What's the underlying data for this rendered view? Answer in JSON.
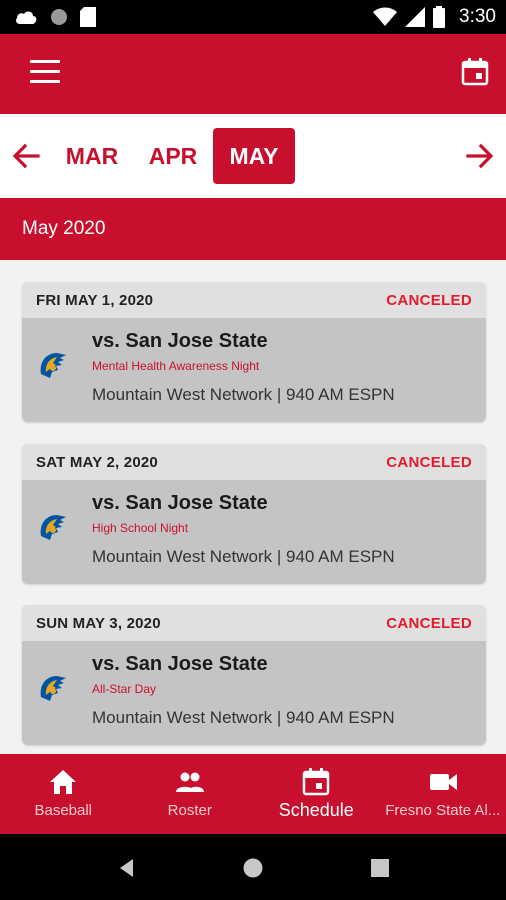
{
  "status_bar": {
    "time": "3:30",
    "icons": [
      "cloud-icon",
      "circle-icon",
      "sd-card-icon",
      "wifi-icon",
      "signal-icon",
      "battery-icon"
    ]
  },
  "app_bar": {
    "menu_icon": "hamburger-menu-icon",
    "calendar_icon": "calendar-icon"
  },
  "month_nav": {
    "prev_icon": "arrow-left-icon",
    "next_icon": "arrow-right-icon",
    "months": [
      "MAR",
      "APR",
      "MAY"
    ],
    "selected": "MAY"
  },
  "section": {
    "title": "May 2020"
  },
  "games": [
    {
      "date": "FRI MAY 1, 2020",
      "status": "CANCELED",
      "opponent": "vs. San Jose State",
      "promo": "Mental Health Awareness Night",
      "broadcast": "Mountain West Network | 940 AM ESPN"
    },
    {
      "date": "SAT MAY 2, 2020",
      "status": "CANCELED",
      "opponent": "vs. San Jose State",
      "promo": "High School Night",
      "broadcast": "Mountain West Network | 940 AM ESPN"
    },
    {
      "date": "SUN MAY 3, 2020",
      "status": "CANCELED",
      "opponent": "vs. San Jose State",
      "promo": "All-Star Day",
      "broadcast": "Mountain West Network | 940 AM ESPN"
    }
  ],
  "bottom_nav": [
    {
      "label": "Baseball",
      "icon": "home-icon",
      "active": false
    },
    {
      "label": "Roster",
      "icon": "people-icon",
      "active": false
    },
    {
      "label": "Schedule",
      "icon": "calendar-event-icon",
      "active": true
    },
    {
      "label": "Fresno State Al...",
      "icon": "video-camera-icon",
      "active": false
    }
  ],
  "colors": {
    "brand_red": "#c8102e",
    "canceled_red": "#e21b2d",
    "card_header": "#e0e0e0",
    "card_body": "#c4c4c4"
  }
}
